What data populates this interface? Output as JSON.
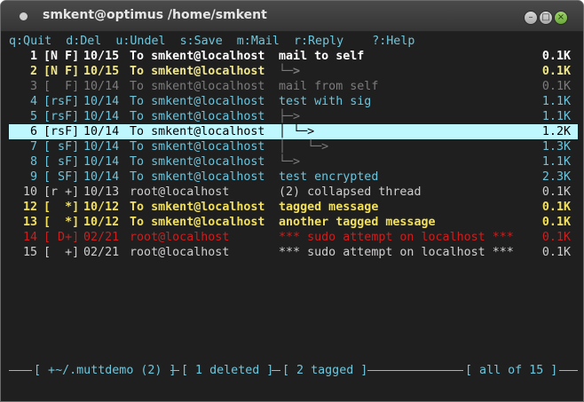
{
  "window": {
    "title": "smkent@optimus /home/smkent",
    "buttons": {
      "minimize": "–",
      "maximize": "□",
      "close": "×"
    }
  },
  "help_bar": "q:Quit  d:Del  u:Undel  s:Save  m:Mail  r:Reply    ?:Help",
  "messages": [
    {
      "num": "1",
      "flags": "[N F]",
      "date": "10/15",
      "from": "To smkent@localhost",
      "tree": "",
      "subject": "mail to self",
      "size": "0.1K",
      "style": "white bold"
    },
    {
      "num": "2",
      "flags": "[N F]",
      "date": "10/15",
      "from": "To smkent@localhost",
      "tree": "└─>",
      "subject": "",
      "size": "0.1K",
      "style": "yellow bold"
    },
    {
      "num": "3",
      "flags": "[  F]",
      "date": "10/14",
      "from": "To smkent@localhost",
      "tree": "",
      "subject": "mail from self",
      "size": "0.1K",
      "style": "grey"
    },
    {
      "num": "4",
      "flags": "[rsF]",
      "date": "10/14",
      "from": "To smkent@localhost",
      "tree": "",
      "subject": "test with sig",
      "size": "1.1K",
      "style": "cyan"
    },
    {
      "num": "5",
      "flags": "[rsF]",
      "date": "10/14",
      "from": "To smkent@localhost",
      "tree": "├─>",
      "subject": "",
      "size": "1.1K",
      "style": "cyan"
    },
    {
      "num": "6",
      "flags": "[rsF]",
      "date": "10/14",
      "from": "To smkent@localhost",
      "tree": "│ └─>",
      "subject": "",
      "size": "1.2K",
      "style": "selected"
    },
    {
      "num": "7",
      "flags": "[ sF]",
      "date": "10/14",
      "from": "To smkent@localhost",
      "tree": "│   └─>",
      "subject": "",
      "size": "1.3K",
      "style": "cyan"
    },
    {
      "num": "8",
      "flags": "[ sF]",
      "date": "10/14",
      "from": "To smkent@localhost",
      "tree": "└─>",
      "subject": "",
      "size": "1.1K",
      "style": "cyan"
    },
    {
      "num": "9",
      "flags": "[ SF]",
      "date": "10/14",
      "from": "To smkent@localhost",
      "tree": "",
      "subject": "test encrypted",
      "size": "2.3K",
      "style": "cyan"
    },
    {
      "num": "10",
      "flags": "[r +]",
      "date": "10/13",
      "from": "root@localhost",
      "tree": "",
      "subject": "(2) collapsed thread",
      "size": "0.1K",
      "style": "lightgrey"
    },
    {
      "num": "12",
      "flags": "[  *]",
      "date": "10/12",
      "from": "To smkent@localhost",
      "tree": "",
      "subject": "tagged message",
      "size": "0.1K",
      "style": "yellowbold"
    },
    {
      "num": "13",
      "flags": "[  *]",
      "date": "10/12",
      "from": "To smkent@localhost",
      "tree": "",
      "subject": "another tagged message",
      "size": "0.1K",
      "style": "yellowbold"
    },
    {
      "num": "14",
      "flags": "[ D+]",
      "date": "02/21",
      "from": "root@localhost",
      "tree": "",
      "subject": "*** sudo attempt on localhost ***",
      "size": "0.1K",
      "style": "red"
    },
    {
      "num": "15",
      "flags": "[  +]",
      "date": "02/21",
      "from": "root@localhost",
      "tree": "",
      "subject": "*** sudo attempt on localhost ***",
      "size": "0.1K",
      "style": "lightgrey"
    }
  ],
  "status_bar": {
    "folder": "[ +~/.muttdemo (2) ]",
    "deleted": "[ 1 deleted ]",
    "tagged": "[ 2 tagged ]",
    "position": "[ all of 15 ]"
  },
  "colors": {
    "terminal_bg": "#1f1f1f",
    "selected_bg": "#bff7ff",
    "cyan": "#6cc4dc",
    "yellow": "#f2e05a",
    "red": "#cc1f1f"
  }
}
